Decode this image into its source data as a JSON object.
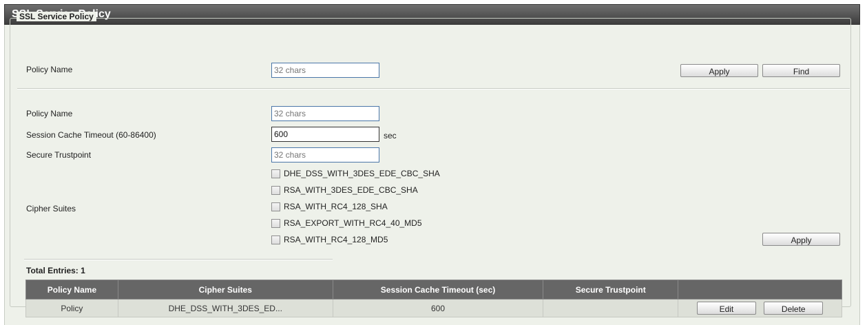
{
  "page_title": "SSL Service Policy",
  "section_legend": "SSL Service Policy",
  "find_form": {
    "policy_name_label": "Policy Name",
    "policy_name_placeholder": "32 chars",
    "apply_label": "Apply",
    "find_label": "Find"
  },
  "config_form": {
    "policy_name_label": "Policy Name",
    "policy_name_placeholder": "32 chars",
    "session_timeout_label": "Session Cache Timeout (60-86400)",
    "session_timeout_value": "600",
    "session_timeout_unit": "sec",
    "trustpoint_label": "Secure Trustpoint",
    "trustpoint_placeholder": "32 chars",
    "cipher_suites_label": "Cipher Suites",
    "cipher_suites": [
      "DHE_DSS_WITH_3DES_EDE_CBC_SHA",
      "RSA_WITH_3DES_EDE_CBC_SHA",
      "RSA_WITH_RC4_128_SHA",
      "RSA_EXPORT_WITH_RC4_40_MD5",
      "RSA_WITH_RC4_128_MD5"
    ],
    "apply_label": "Apply"
  },
  "table": {
    "total_entries": "Total Entries: 1",
    "headers": [
      "Policy Name",
      "Cipher Suites",
      "Session Cache Timeout (sec)",
      "Secure Trustpoint",
      ""
    ],
    "rows": [
      {
        "policy_name": "Policy",
        "cipher_suites": "DHE_DSS_WITH_3DES_ED...",
        "session_timeout": "600",
        "trustpoint": "",
        "edit_label": "Edit",
        "delete_label": "Delete"
      }
    ]
  }
}
